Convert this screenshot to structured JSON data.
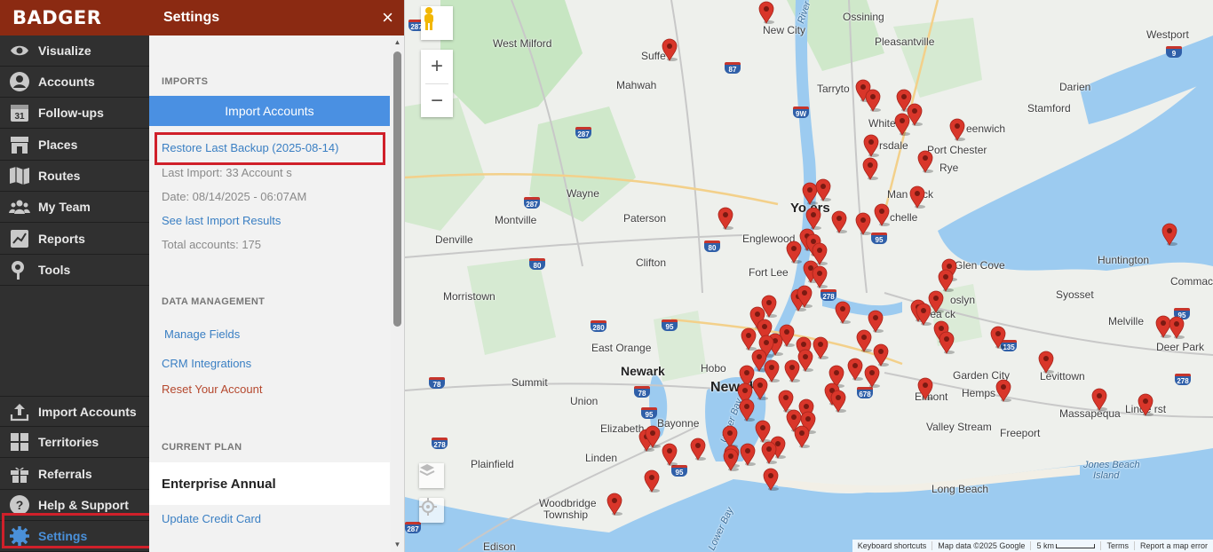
{
  "app": {
    "logo": "BADGER"
  },
  "nav": {
    "items": [
      {
        "label": "Visualize",
        "icon": "eye-icon"
      },
      {
        "label": "Accounts",
        "icon": "person-icon"
      },
      {
        "label": "Follow-ups",
        "icon": "calendar-icon",
        "icon_text": "31"
      },
      {
        "label": "Places",
        "icon": "store-icon"
      },
      {
        "label": "Routes",
        "icon": "map-route-icon"
      },
      {
        "label": "My Team",
        "icon": "team-icon"
      },
      {
        "label": "Reports",
        "icon": "report-icon"
      },
      {
        "label": "Tools",
        "icon": "tools-icon"
      }
    ],
    "bottom_items": [
      {
        "label": "Import Accounts",
        "icon": "upload-icon"
      },
      {
        "label": "Territories",
        "icon": "territories-icon"
      },
      {
        "label": "Referrals",
        "icon": "gift-icon"
      },
      {
        "label": "Help & Support",
        "icon": "help-icon"
      },
      {
        "label": "Settings",
        "icon": "gear-icon",
        "active": true
      }
    ],
    "active_color": "#4a90d9"
  },
  "settings": {
    "title": "Settings",
    "close": "×",
    "imports": {
      "heading": "IMPORTS",
      "import_button": "Import Accounts",
      "restore_link": "Restore Last Backup (2025-08-14)",
      "last_import": "Last Import: 33 Account s",
      "date": "Date: 08/14/2025 - 06:07AM",
      "results_link": "See last Import Results",
      "total": "Total accounts: 175"
    },
    "data_management": {
      "heading": "DATA MANAGEMENT",
      "manage_fields": "Manage Fields",
      "crm": "CRM Integrations",
      "reset": "Reset Your Account"
    },
    "plan": {
      "heading": "CURRENT PLAN",
      "name": "Enterprise Annual",
      "update_card": "Update Credit Card"
    }
  },
  "map": {
    "labels": {
      "west_milford": "West Milford",
      "new_city": "New City",
      "ossining": "Ossining",
      "pleasantville": "Pleasantville",
      "westport": "Westport",
      "suffern": "Suffe",
      "mahwah": "Mahwah",
      "tarrytown": "Tarryto",
      "darien": "Darien",
      "stamford": "Stamford",
      "white_plains": "White",
      "greenwich": "eenwich",
      "scarsdale": "rsdale",
      "port_chester": "Port Chester",
      "rye": "Rye",
      "wayne": "Wayne",
      "mamaroneck": "Man    neck",
      "yonkers": "Yo   ers",
      "montville": "Montville",
      "paterson": "Paterson",
      "new_rochelle": "chelle",
      "englewood": "Englewood",
      "denville": "Denville",
      "huntington": "Huntington",
      "clifton": "Clifton",
      "glen_cove": "Glen Cove",
      "fort_lee": "Fort Lee",
      "commack": "Commack",
      "syosset": "Syosset",
      "morristown": "Morristown",
      "roslyn": "oslyn",
      "great_neck": "Grea  ck",
      "melville": "Melville",
      "deer_park": "Deer Park",
      "east_orange": "East Orange",
      "newark": "Newark",
      "hoboken": "Hobo",
      "new_york": "New   rk",
      "garden_city": "Garden City",
      "levittown": "Levittown",
      "summit": "Summit",
      "hempstead": "Hemps",
      "elmont": "Elmont",
      "union": "Union",
      "massapequa": "Massapequa",
      "lindenhurst": "Linde    rst",
      "bayonne": "Bayonne",
      "elizabeth": "Elizabeth",
      "valley_stream": "Valley Stream",
      "freeport": "Freeport",
      "plainfield": "Plainfield",
      "linden": "Linden",
      "jones_beach": "Jones Beach",
      "island": "Island",
      "long_beach": "Long Beach",
      "woodbridge": "Woodbridge",
      "township": "Township",
      "edison": "Edison",
      "upper_bay": "Upper Bay",
      "lower_bay": "Lower Bay",
      "river": "River"
    },
    "shields": [
      "287",
      "87",
      "9W",
      "287",
      "287",
      "80",
      "80",
      "95",
      "278",
      "280",
      "95",
      "78",
      "678",
      "95",
      "135",
      "78",
      "278",
      "95",
      "287",
      "95",
      "9",
      "278"
    ],
    "zoom_in": "+",
    "zoom_out": "−",
    "footer": {
      "shortcuts": "Keyboard shortcuts",
      "map_data": "Map data ©2025 Google",
      "scale": "5 km",
      "terms": "Terms",
      "report": "Report a map error"
    },
    "colors": {
      "water": "#9ccbf0",
      "land": "#eef0ec",
      "park": "#c7e6c2",
      "pin": "#d9362a"
    }
  }
}
